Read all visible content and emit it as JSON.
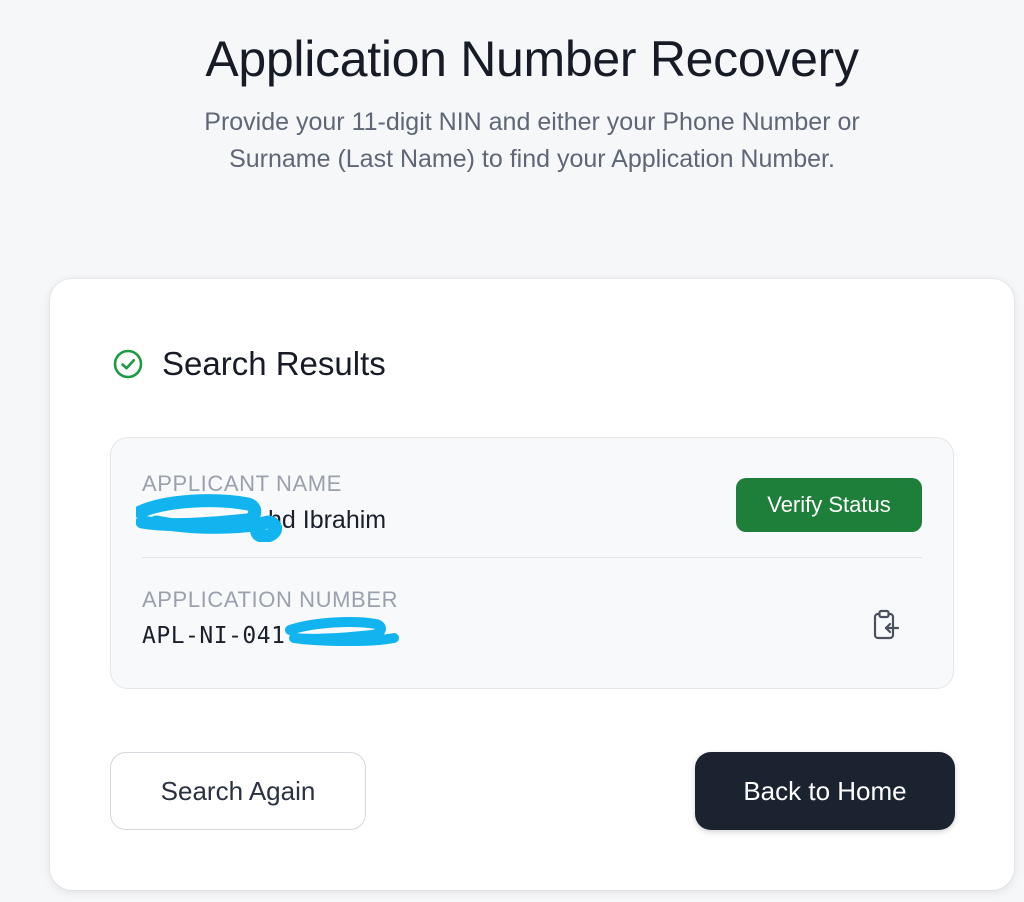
{
  "header": {
    "title": "Application Number Recovery",
    "subtitle": "Provide your 11-digit NIN and either your Phone Number or Surname (Last Name) to find your Application Number."
  },
  "results": {
    "title": "Search Results",
    "icon": "check-circle-icon",
    "applicant_name": {
      "label": "APPLICANT NAME",
      "value_visible": "hd Ibrahim"
    },
    "verify_button_label": "Verify Status",
    "application_number": {
      "label": "APPLICATION NUMBER",
      "value_visible": "APL-NI-041"
    },
    "copy_icon": "clipboard-copy-icon"
  },
  "actions": {
    "search_again_label": "Search Again",
    "back_home_label": "Back to Home"
  },
  "colors": {
    "success_green": "#1d7f3a",
    "dark_button": "#1c2330",
    "redaction_blue": "#12b4f0"
  }
}
